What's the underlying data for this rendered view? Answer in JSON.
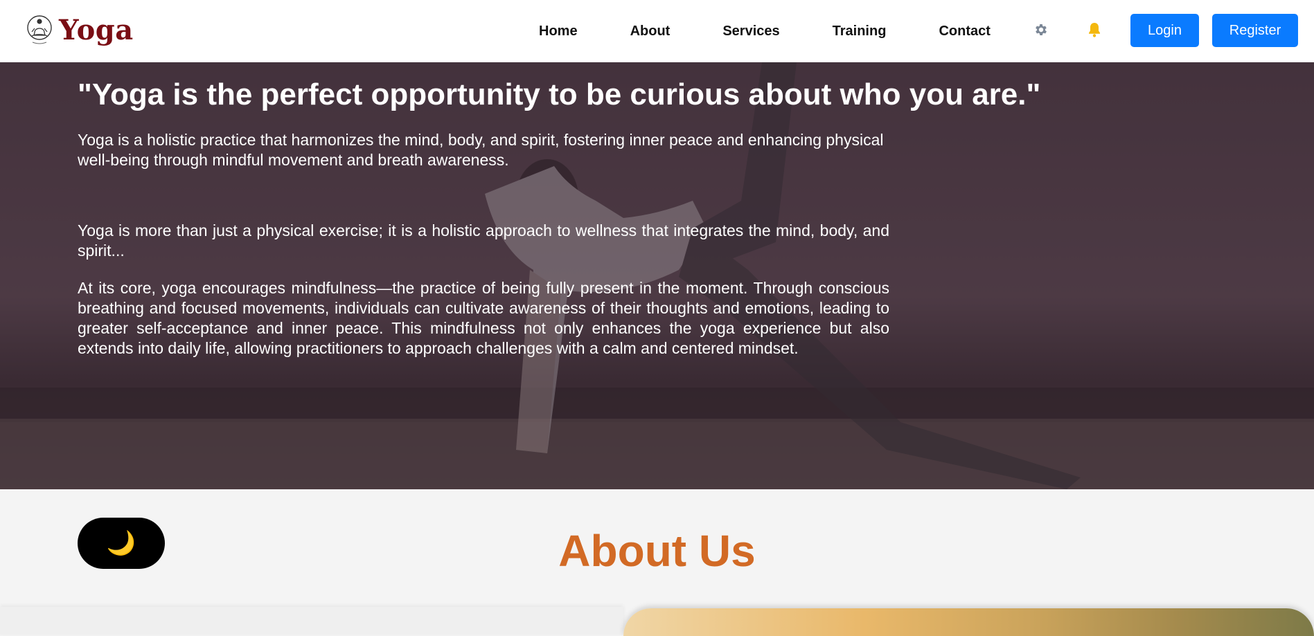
{
  "brand": {
    "name": "Yoga",
    "logo_icon": "meditation-emblem"
  },
  "nav": {
    "items": [
      {
        "label": "Home"
      },
      {
        "label": "About"
      },
      {
        "label": "Services"
      },
      {
        "label": "Training"
      },
      {
        "label": "Contact"
      }
    ],
    "settings_icon": "gear-icon",
    "notifications_icon": "bell-icon",
    "login_label": "Login",
    "register_label": "Register"
  },
  "hero": {
    "quote": "\"Yoga is the perfect opportunity to be curious about who you are.\"",
    "intro": "Yoga is a holistic practice that harmonizes the mind, body, and spirit, fostering inner peace and enhancing physical well-being through mindful movement and breath awareness.",
    "paragraph_1": "Yoga is more than just a physical exercise; it is a holistic approach to wellness that integrates the mind, body, and spirit...",
    "paragraph_2": "At its core, yoga encourages mindfulness—the practice of being fully present in the moment. Through conscious breathing and focused movements, individuals can cultivate awareness of their thoughts and emotions, leading to greater self-acceptance and inner peace. This mindfulness not only enhances the yoga experience but also extends into daily life, allowing practitioners to approach challenges with a calm and centered mindset."
  },
  "about": {
    "theme_toggle_icon": "moon-icon",
    "theme_toggle_glyph": "🌙",
    "title": "About Us"
  },
  "colors": {
    "brand": "#7a0e14",
    "accent": "#d26a25",
    "button": "#0a7bff"
  }
}
